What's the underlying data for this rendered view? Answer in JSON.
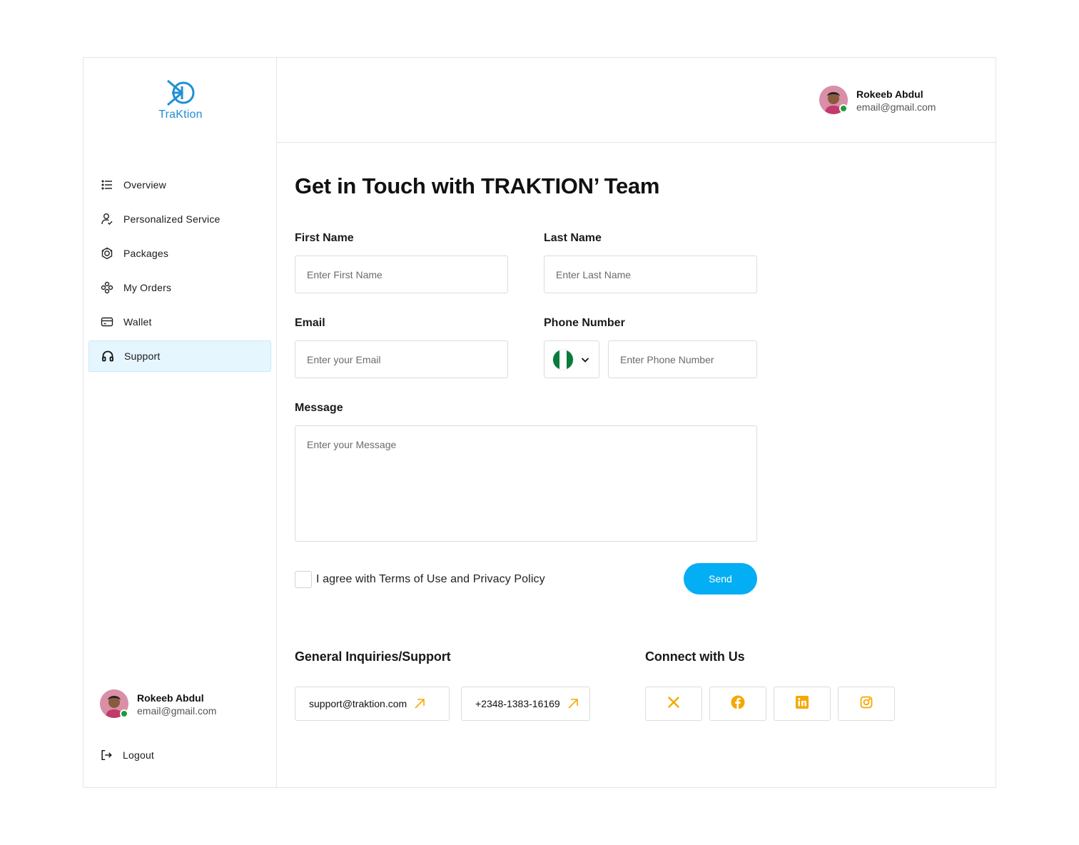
{
  "brand": {
    "logo_text": "TraKtion"
  },
  "user": {
    "name": "Rokeeb Abdul",
    "email": "email@gmail.com"
  },
  "sidebar": {
    "items": [
      {
        "label": "Overview",
        "icon": "list-icon",
        "active": false
      },
      {
        "label": "Personalized Service",
        "icon": "user-check-icon",
        "active": false
      },
      {
        "label": "Packages",
        "icon": "package-icon",
        "active": false
      },
      {
        "label": "My Orders",
        "icon": "orders-icon",
        "active": false
      },
      {
        "label": "Wallet",
        "icon": "wallet-icon",
        "active": false
      },
      {
        "label": "Support",
        "icon": "headphones-icon",
        "active": true
      }
    ],
    "logout_label": "Logout"
  },
  "form": {
    "title": "Get in Touch with TRAKTION’ Team",
    "first_name": {
      "label": "First Name",
      "placeholder": "Enter First Name"
    },
    "last_name": {
      "label": "Last Name",
      "placeholder": "Enter Last Name"
    },
    "email": {
      "label": "Email",
      "placeholder": "Enter your Email"
    },
    "phone": {
      "label": "Phone Number",
      "placeholder": "Enter Phone Number",
      "country": "Nigeria"
    },
    "message": {
      "label": "Message",
      "placeholder": "Enter your Message"
    },
    "agree_text": "I agree with Terms of Use and Privacy Policy",
    "send_label": "Send"
  },
  "support": {
    "title": "General Inquiries/Support",
    "email": "support@traktion.com",
    "phone": "+2348-1383-16169"
  },
  "connect": {
    "title": "Connect with Us",
    "networks": [
      "x-icon",
      "facebook-icon",
      "linkedin-icon",
      "instagram-icon"
    ]
  },
  "colors": {
    "accent": "#04aef4",
    "active_bg": "#e6f6fe",
    "social_icon": "#f5a800",
    "online": "#1d9b3a",
    "brand_blue": "#1f8fd6"
  }
}
